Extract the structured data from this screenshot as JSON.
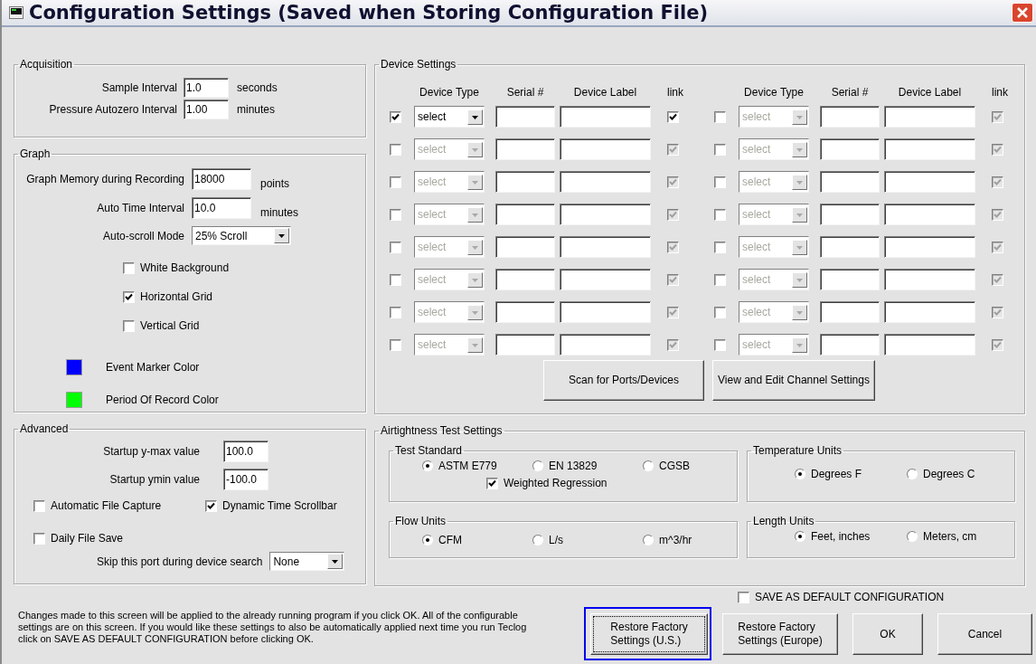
{
  "window": {
    "title": "Configuration Settings (Saved when Storing Configuration File)"
  },
  "acquisition": {
    "title": "Acquisition",
    "fields": [
      {
        "label": "Sample Interval",
        "value": "1.0",
        "unit": "seconds"
      },
      {
        "label": "Pressure Autozero Interval",
        "value": "1.00",
        "unit": "minutes"
      }
    ]
  },
  "graph": {
    "title": "Graph",
    "fields": [
      {
        "kind": "input",
        "label": "Graph Memory during Recording",
        "value": "18000",
        "unit": "points"
      },
      {
        "kind": "input",
        "label": "Auto Time Interval",
        "value": "10.0",
        "unit": "minutes"
      },
      {
        "kind": "dropdown",
        "label": "Auto-scroll Mode",
        "value": "25% Scroll"
      }
    ],
    "checkboxes": [
      {
        "label": "White Background",
        "checked": false
      },
      {
        "label": "Horizontal Grid",
        "checked": true
      },
      {
        "label": "Vertical Grid",
        "checked": false
      }
    ],
    "colors": [
      {
        "label": "Event Marker Color",
        "color": "#0000ff"
      },
      {
        "label": "Period Of Record Color",
        "color": "#00ff00"
      }
    ]
  },
  "advanced": {
    "title": "Advanced",
    "fields": [
      {
        "label": "Startup y-max value",
        "value": "100.0"
      },
      {
        "label": "Startup ymin value",
        "value": "-100.0"
      }
    ],
    "checkboxes": [
      {
        "label": "Automatic File Capture",
        "checked": false
      },
      {
        "label": "Dynamic Time Scrollbar",
        "checked": true
      },
      {
        "label": "Daily File Save",
        "checked": false
      }
    ],
    "skip_port": {
      "label": "Skip this port during device search",
      "value": "None"
    }
  },
  "device_settings": {
    "title": "Device Settings",
    "halves": [
      {
        "headers": [
          "Device Type",
          "Serial #",
          "Device Label",
          "link"
        ],
        "rows": [
          {
            "checked": true,
            "type": "select",
            "link": true
          },
          {
            "checked": false,
            "type": "select",
            "link": true
          },
          {
            "checked": false,
            "type": "select",
            "link": true
          },
          {
            "checked": false,
            "type": "select",
            "link": true
          },
          {
            "checked": false,
            "type": "select",
            "link": true
          },
          {
            "checked": false,
            "type": "select",
            "link": true
          },
          {
            "checked": false,
            "type": "select",
            "link": true
          },
          {
            "checked": false,
            "type": "select",
            "link": true
          }
        ]
      },
      {
        "headers": [
          "Device Type",
          "Serial #",
          "Device Label",
          "link"
        ],
        "rows": [
          {
            "checked": false,
            "type": "select",
            "link": true
          },
          {
            "checked": false,
            "type": "select",
            "link": true
          },
          {
            "checked": false,
            "type": "select",
            "link": true
          },
          {
            "checked": false,
            "type": "select",
            "link": true
          },
          {
            "checked": false,
            "type": "select",
            "link": true
          },
          {
            "checked": false,
            "type": "select",
            "link": true
          },
          {
            "checked": false,
            "type": "select",
            "link": true
          },
          {
            "checked": false,
            "type": "select",
            "link": true
          }
        ]
      }
    ],
    "buttons": [
      "Scan for Ports/Devices",
      "View and Edit Channel Settings"
    ]
  },
  "airtightness": {
    "title": "Airtightness Test Settings",
    "groups": [
      {
        "title": "Test Standard",
        "options": [
          {
            "label": "ASTM E779",
            "selected": true
          },
          {
            "label": "EN 13829",
            "selected": false
          },
          {
            "label": "CGSB",
            "selected": false
          }
        ],
        "checkbox": {
          "label": "Weighted Regression",
          "checked": true
        }
      },
      {
        "title": "Temperature Units",
        "options": [
          {
            "label": "Degrees F",
            "selected": true
          },
          {
            "label": "Degrees C",
            "selected": false
          }
        ]
      },
      {
        "title": "Flow Units",
        "options": [
          {
            "label": "CFM",
            "selected": true
          },
          {
            "label": "L/s",
            "selected": false
          },
          {
            "label": "m^3/hr",
            "selected": false
          }
        ]
      },
      {
        "title": "Length Units",
        "options": [
          {
            "label": "Feet, inches",
            "selected": true
          },
          {
            "label": "Meters, cm",
            "selected": false
          }
        ]
      }
    ]
  },
  "footer": {
    "note": "Changes made to this screen will be applied to the already running program if you click OK. All of the configurable\nsettings are on this screen. If you would like these settings to also be automatically applied next time you run Teclog\nclick on SAVE AS DEFAULT CONFIGURATION before clicking OK.",
    "save_default": {
      "label": "SAVE AS DEFAULT CONFIGURATION",
      "checked": false
    },
    "buttons": [
      {
        "label": "Restore Factory\nSettings (U.S.)",
        "focused": true
      },
      {
        "label": "Restore Factory\nSettings (Europe)",
        "focused": false
      },
      {
        "label": "OK",
        "focused": false
      },
      {
        "label": "Cancel",
        "focused": false
      }
    ]
  }
}
